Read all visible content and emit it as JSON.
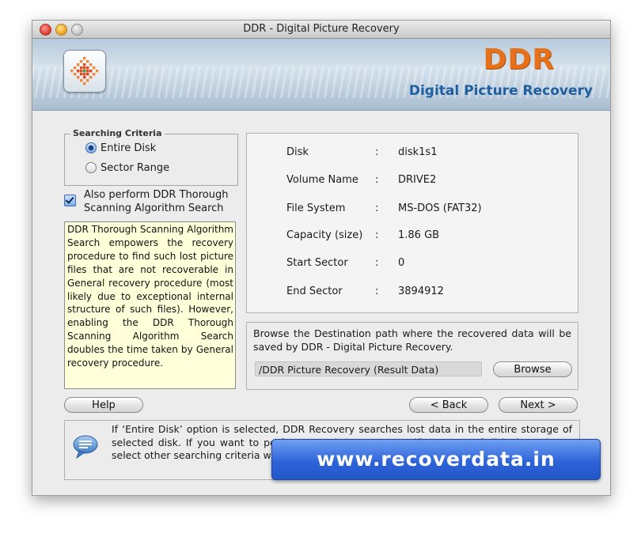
{
  "window": {
    "title": "DDR - Digital Picture Recovery"
  },
  "banner": {
    "brand": "DDR",
    "product": "Digital Picture Recovery",
    "logo_icon": "pixel-grid-icon"
  },
  "criteria": {
    "legend": "Searching Criteria",
    "options": [
      "Entire Disk",
      "Sector Range"
    ],
    "selected": "Entire Disk"
  },
  "thorough": {
    "checked": true,
    "label": "Also perform DDR Thorough Scanning Algorithm Search",
    "description": "DDR Thorough Scanning Algorithm Search empowers the recovery procedure to find such lost picture files that are not recoverable in General recovery procedure (most likely due to exceptional internal structure of such files). However, enabling the DDR Thorough Scanning Algorithm Search doubles the time taken by General recovery procedure."
  },
  "disk_info": {
    "separator": ":",
    "rows": [
      {
        "label": "Disk",
        "value": "disk1s1"
      },
      {
        "label": "Volume Name",
        "value": "DRIVE2"
      },
      {
        "label": "File System",
        "value": "MS-DOS (FAT32)"
      },
      {
        "label": "Capacity (size)",
        "value": "1.86  GB"
      },
      {
        "label": "Start Sector",
        "value": "0"
      },
      {
        "label": "End Sector",
        "value": "3894912"
      }
    ]
  },
  "destination": {
    "instructions": "Browse the Destination path where the recovered data will be saved by DDR - Digital Picture Recovery.",
    "path": "/DDR Picture Recovery (Result Data)",
    "browse_label": "Browse"
  },
  "nav": {
    "help_label": "Help",
    "back_label": "< Back",
    "next_label": "Next >"
  },
  "tip": {
    "icon": "speech-bubble-icon",
    "text": "If ‘Entire Disk’ option is selected, DDR Recovery searches lost data in the entire storage of selected disk. If you want to perform search in some specific sectors of disk then please select other searching criteria which allows you to perform recovery in part of Entire disk."
  },
  "watermark": {
    "text": "www.recoverdata.in"
  },
  "colors": {
    "brand_orange": "#e7701a",
    "product_blue": "#1f5fa0",
    "help_bg": "#ffffd9",
    "watermark_blue": "#2f64d9"
  }
}
